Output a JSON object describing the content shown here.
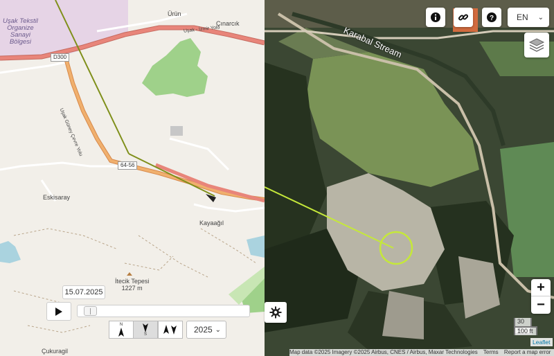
{
  "left_map": {
    "places": [
      {
        "name": "Ürün"
      },
      {
        "name": "Çınarcık"
      },
      {
        "name": "Uşak Tekstil\nOrganize\nSanayi\nBölgesi"
      },
      {
        "name": "Eskisaray"
      },
      {
        "name": "Kayaağıl"
      },
      {
        "name": "İtecik Tepesi\n1227 m"
      },
      {
        "name": "Çukuragil"
      }
    ],
    "road_labels": [
      "D300",
      "64-56",
      "Uşak - İzmir Yolu",
      "Uşak Güney Çevre Yolu"
    ]
  },
  "right_map": {
    "stream_label": "Karabal Stream"
  },
  "controls": {
    "info_icon": "info-icon",
    "link_icon": "link-icon",
    "help_icon": "help-icon",
    "language": "EN",
    "layers_icon": "layers-icon",
    "zoom_in": "+",
    "zoom_out": "−",
    "scale_metric": "30 m",
    "scale_imperial": "100 ft",
    "leaflet": "Leaflet"
  },
  "attribution": {
    "data": "Map data ©2025 Imagery ©2025 Airbus, CNES / Airbus, Maxar Technologies",
    "terms": "Terms",
    "report": "Report a map error"
  },
  "timeline": {
    "date": "15.07.2025",
    "position_fraction": 0.02,
    "year": "2025",
    "orientations": [
      {
        "top": "N",
        "bottom": "",
        "id": "north-up"
      },
      {
        "top": "N",
        "bottom": "S",
        "id": "south-up"
      },
      {
        "top": "N",
        "bottom": "S",
        "id": "heading"
      }
    ]
  },
  "colors": {
    "sight_line": "#7f8f1a",
    "sight_line_sat": "#c5e83a",
    "road_orange": "#f0a35e",
    "road_pink": "#e8857a",
    "industrial": "#e6d4e6",
    "forest": "#9fd18a"
  }
}
